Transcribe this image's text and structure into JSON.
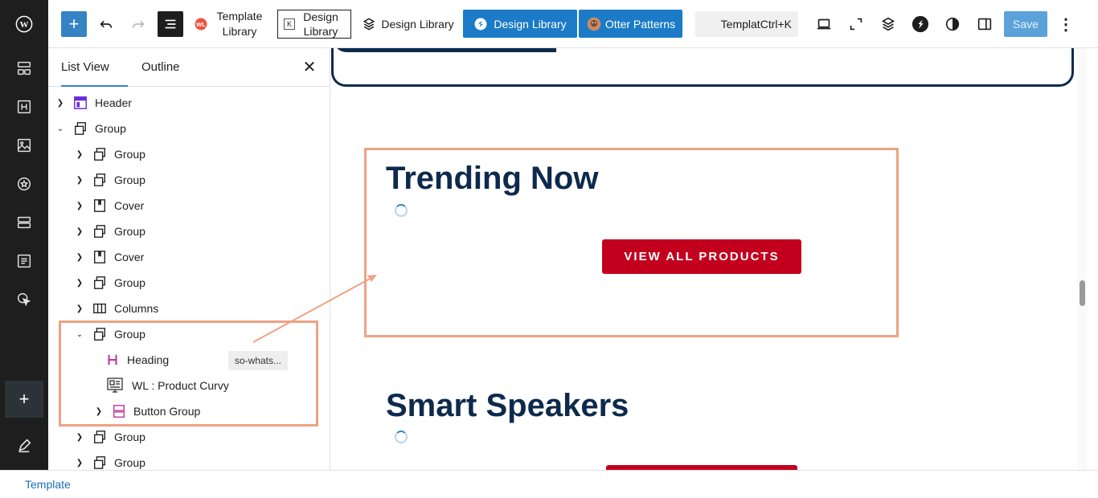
{
  "toolbar": {
    "template_library": "Template Library",
    "design_library_outline": "Design Library",
    "design_library_plain": "Design Library",
    "design_library_blue": "Design Library",
    "otter_patterns": "Otter Patterns",
    "search_label": "Templat",
    "search_shortcut": "Ctrl+K",
    "save": "Save"
  },
  "panel": {
    "tabs": [
      "List View",
      "Outline"
    ],
    "items": [
      {
        "label": "Header",
        "icon": "header-block-icon"
      },
      {
        "label": "Group",
        "icon": "group-block-icon"
      },
      {
        "label": "Group",
        "icon": "group-block-icon"
      },
      {
        "label": "Group",
        "icon": "group-block-icon"
      },
      {
        "label": "Cover",
        "icon": "cover-block-icon"
      },
      {
        "label": "Group",
        "icon": "group-block-icon"
      },
      {
        "label": "Cover",
        "icon": "cover-block-icon"
      },
      {
        "label": "Group",
        "icon": "group-block-icon"
      },
      {
        "label": "Columns",
        "icon": "columns-block-icon"
      },
      {
        "label": "Group",
        "icon": "group-block-icon"
      },
      {
        "label": "Heading",
        "icon": "heading-block-icon",
        "badge": "so-whats..."
      },
      {
        "label": "WL : Product Curvy",
        "icon": "product-curvy-icon"
      },
      {
        "label": "Button Group",
        "icon": "button-group-icon"
      },
      {
        "label": "Group",
        "icon": "group-block-icon"
      },
      {
        "label": "Group",
        "icon": "group-block-icon"
      }
    ]
  },
  "canvas": {
    "section1_heading": "Trending Now",
    "section1_button": "VIEW ALL PRODUCTS",
    "section2_heading": "Smart Speakers"
  },
  "footer": {
    "breadcrumb": "Template"
  },
  "colors": {
    "highlight": "#eea283",
    "navy": "#0d2a4d",
    "cta_red": "#c2001e",
    "wp_blue": "#3582c4"
  }
}
